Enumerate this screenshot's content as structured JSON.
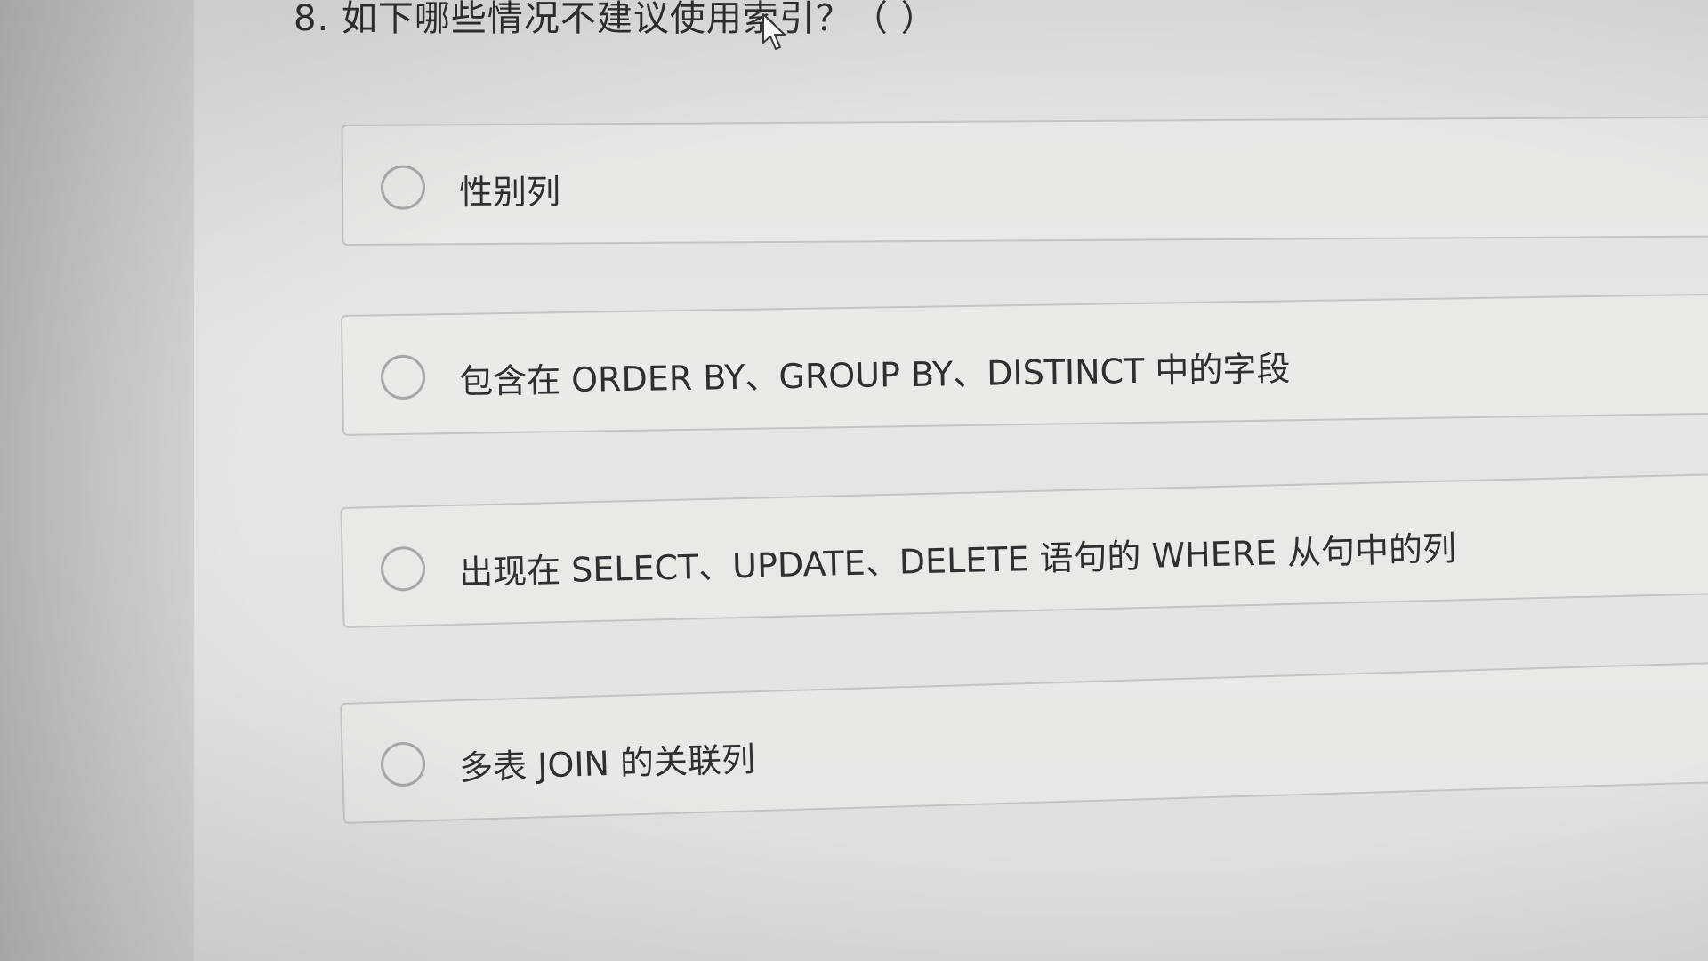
{
  "question": {
    "title": "8. 如下哪些情况不建议使用索引？（  ）"
  },
  "options": [
    {
      "label": "性别列",
      "selected": false
    },
    {
      "label": "包含在 ORDER BY、GROUP BY、DISTINCT 中的字段",
      "selected": false
    },
    {
      "label": "出现在 SELECT、UPDATE、DELETE 语句的 WHERE 从句中的列",
      "selected": false
    },
    {
      "label": "多表 JOIN 的关联列",
      "selected": false
    }
  ],
  "colors": {
    "text": "#2f2f2f",
    "border": "#c4c4c2",
    "radio_border": "#a8a8a6",
    "background": "#e4e4e2"
  },
  "icons": {
    "radio": "radio-unchecked-icon",
    "cursor": "mouse-pointer-icon"
  }
}
